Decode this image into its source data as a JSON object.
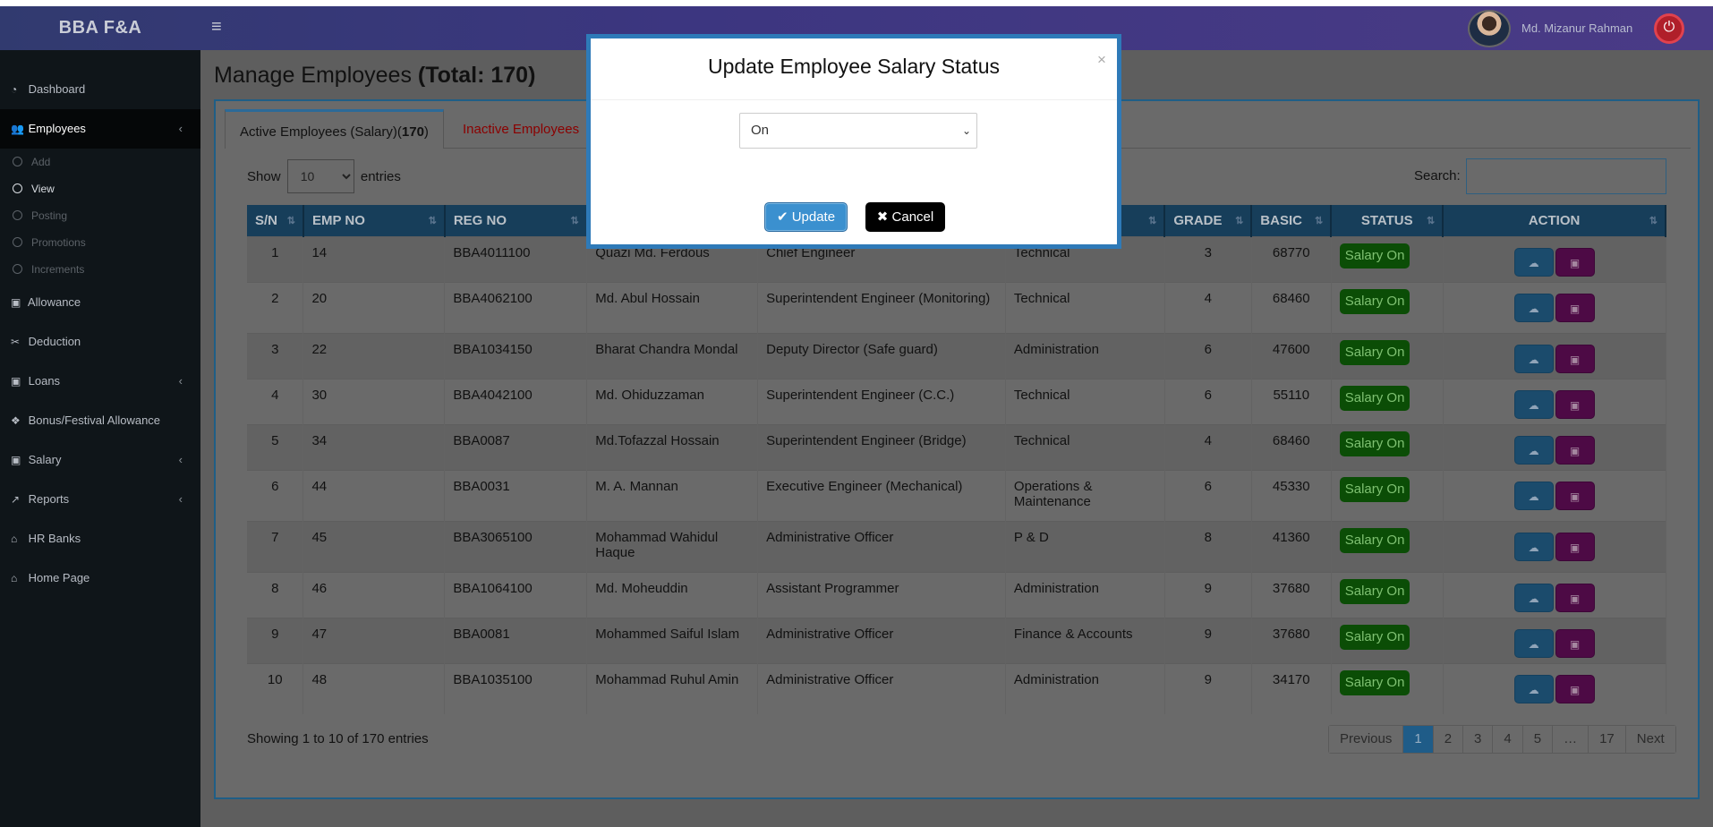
{
  "header": {
    "brand": "BBA F&A",
    "toggle_icon": "≡",
    "username": "Md. Mizanur Rahman"
  },
  "sidebar": {
    "items": [
      {
        "label": "Dashboard",
        "icon": "dashboard-icon"
      },
      {
        "label": "Employees",
        "icon": "users-icon",
        "active": true
      },
      {
        "label": "Allowance",
        "icon": "money-icon"
      },
      {
        "label": "Deduction",
        "icon": "scissors-icon"
      },
      {
        "label": "Loans",
        "icon": "money-icon"
      },
      {
        "label": "Bonus/Festival Allowance",
        "icon": "cubes-icon"
      },
      {
        "label": "Salary",
        "icon": "money-icon"
      },
      {
        "label": "Reports",
        "icon": "chart-icon"
      },
      {
        "label": "HR Banks",
        "icon": "bank-icon"
      },
      {
        "label": "Home Page",
        "icon": "home-icon"
      }
    ],
    "employee_sub": [
      "Add",
      "View",
      "Posting",
      "Promotions",
      "Increments"
    ]
  },
  "page": {
    "title_prefix": "Manage Employees ",
    "title_total": "(Total: 170)"
  },
  "tabs": {
    "active_label": "Active Employees (Salary)(",
    "active_count": "170",
    "active_close": ")",
    "inactive_label": "Inactive Employees"
  },
  "controls": {
    "show_label": "Show",
    "entries_value": "10",
    "entries_label": "entries",
    "search_label": "Search:"
  },
  "table": {
    "headers": [
      "S/N",
      "EMP NO",
      "REG NO",
      "",
      "",
      "",
      "GRADE",
      "BASIC",
      "STATUS",
      "ACTION"
    ],
    "rows": [
      {
        "sn": "1",
        "emp": "14",
        "reg": "BBA4011100",
        "name": "Quazi Md. Ferdous",
        "designation": "Chief Engineer",
        "dept": "Technical",
        "grade": "3",
        "basic": "68770",
        "status": "Salary On"
      },
      {
        "sn": "2",
        "emp": "20",
        "reg": "BBA4062100",
        "name": "Md. Abul Hossain",
        "designation": "Superintendent Engineer (Monitoring)",
        "dept": "Technical",
        "grade": "4",
        "basic": "68460",
        "status": "Salary On"
      },
      {
        "sn": "3",
        "emp": "22",
        "reg": "BBA1034150",
        "name": "Bharat Chandra Mondal",
        "designation": "Deputy Director (Safe guard)",
        "dept": "Administration",
        "grade": "6",
        "basic": "47600",
        "status": "Salary On"
      },
      {
        "sn": "4",
        "emp": "30",
        "reg": "BBA4042100",
        "name": "Md. Ohiduzzaman",
        "designation": "Superintendent Engineer (C.C.)",
        "dept": "Technical",
        "grade": "6",
        "basic": "55110",
        "status": "Salary On"
      },
      {
        "sn": "5",
        "emp": "34",
        "reg": "BBA0087",
        "name": "Md.Tofazzal Hossain",
        "designation": "Superintendent Engineer (Bridge)",
        "dept": "Technical",
        "grade": "4",
        "basic": "68460",
        "status": "Salary On"
      },
      {
        "sn": "6",
        "emp": "44",
        "reg": "BBA0031",
        "name": "M. A. Mannan",
        "designation": "Executive Engineer (Mechanical)",
        "dept": "Operations & Maintenance",
        "grade": "6",
        "basic": "45330",
        "status": "Salary On"
      },
      {
        "sn": "7",
        "emp": "45",
        "reg": "BBA3065100",
        "name": "Mohammad Wahidul Haque",
        "designation": "Administrative Officer",
        "dept": "P & D",
        "grade": "8",
        "basic": "41360",
        "status": "Salary On"
      },
      {
        "sn": "8",
        "emp": "46",
        "reg": "BBA1064100",
        "name": "Md. Moheuddin",
        "designation": "Assistant Programmer",
        "dept": "Administration",
        "grade": "9",
        "basic": "37680",
        "status": "Salary On"
      },
      {
        "sn": "9",
        "emp": "47",
        "reg": "BBA0081",
        "name": "Mohammed Saiful Islam",
        "designation": "Administrative Officer",
        "dept": "Finance & Accounts",
        "grade": "9",
        "basic": "37680",
        "status": "Salary On"
      },
      {
        "sn": "10",
        "emp": "48",
        "reg": "BBA1035100",
        "name": "Mohammad Ruhul Amin",
        "designation": "Administrative Officer",
        "dept": "Administration",
        "grade": "9",
        "basic": "34170",
        "status": "Salary On"
      }
    ]
  },
  "footer": {
    "info": "Showing 1 to 10 of 170 entries",
    "pages": [
      "Previous",
      "1",
      "2",
      "3",
      "4",
      "5",
      "…",
      "17",
      "Next"
    ]
  },
  "modal": {
    "title": "Update Employee Salary Status",
    "close": "×",
    "select_value": "On",
    "update_label": "Update",
    "cancel_label": "Cancel"
  },
  "colors": {
    "header": "#3c3680",
    "sidebar": "#0f1519",
    "table_header": "#173e5a",
    "status_badge": "#0b4d06",
    "update_button": "#3b90cf",
    "modal_border": "#2e7ab8"
  }
}
